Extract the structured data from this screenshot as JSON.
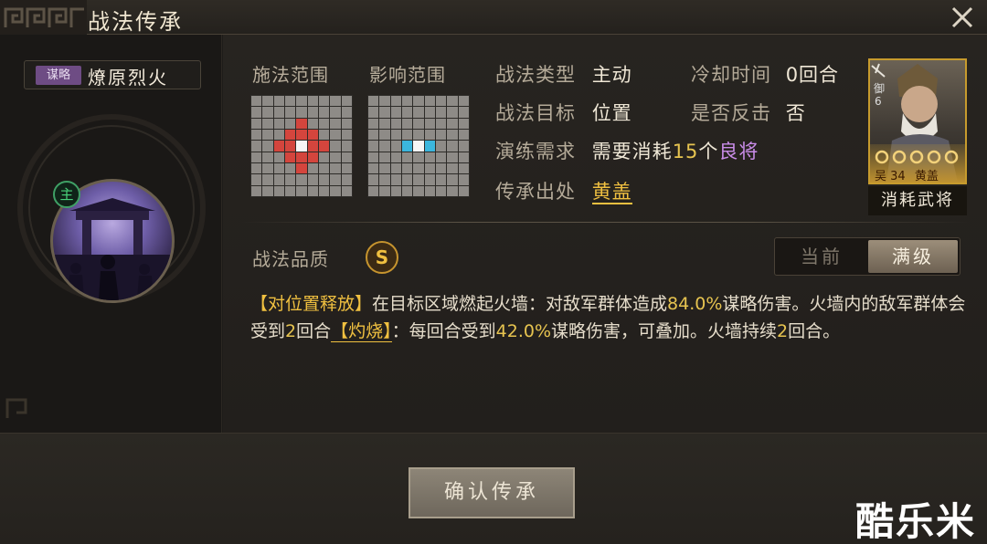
{
  "window": {
    "title": "战法传承"
  },
  "skill": {
    "type_badge": "谋略",
    "name": "燎原烈火",
    "main_badge": "主"
  },
  "ranges": {
    "cast_label": "施法范围",
    "effect_label": "影响范围"
  },
  "info": {
    "type_label": "战法类型",
    "type_value": "主动",
    "cooldown_label": "冷却时间",
    "cooldown_value": "0回合",
    "target_label": "战法目标",
    "target_value": "位置",
    "counter_label": "是否反击",
    "counter_value": "否",
    "require_label": "演练需求",
    "require_prefix": "需要消耗",
    "require_count": "15",
    "require_unit": "个",
    "require_item": "良将",
    "source_label": "传承出处",
    "source_value": "黄盖"
  },
  "card": {
    "side": "御",
    "cost": "6",
    "faction": "吴",
    "level": "34",
    "name": "黄盖",
    "caption": "消耗武将"
  },
  "quality": {
    "label": "战法品质",
    "grade": "S"
  },
  "toggle": {
    "current": "当前",
    "max": "满级"
  },
  "description": {
    "p1_tag": "【对位置释放】",
    "p1_text": "在目标区域燃起火墙：对敌军群体造成",
    "p1_num": "84.0%",
    "p1_text2": "谋略伤害。火墙内的敌军群体会受到",
    "p1_num2": "2",
    "p1_text3": "回合",
    "p1_tag2": "【灼烧】",
    "p1_text4": "：每回合受到",
    "p1_num3": "42.0%",
    "p1_text5": "谋略伤害，可叠加。火墙持续",
    "p1_num4": "2",
    "p1_text6": "回合。"
  },
  "footer": {
    "confirm_label": "确认传承"
  },
  "watermark": "酷乐米",
  "colors": {
    "gold": "#f0c040",
    "purple": "#c98ce8",
    "red_cell": "#d4453d",
    "blue_cell": "#3bb6dd"
  }
}
